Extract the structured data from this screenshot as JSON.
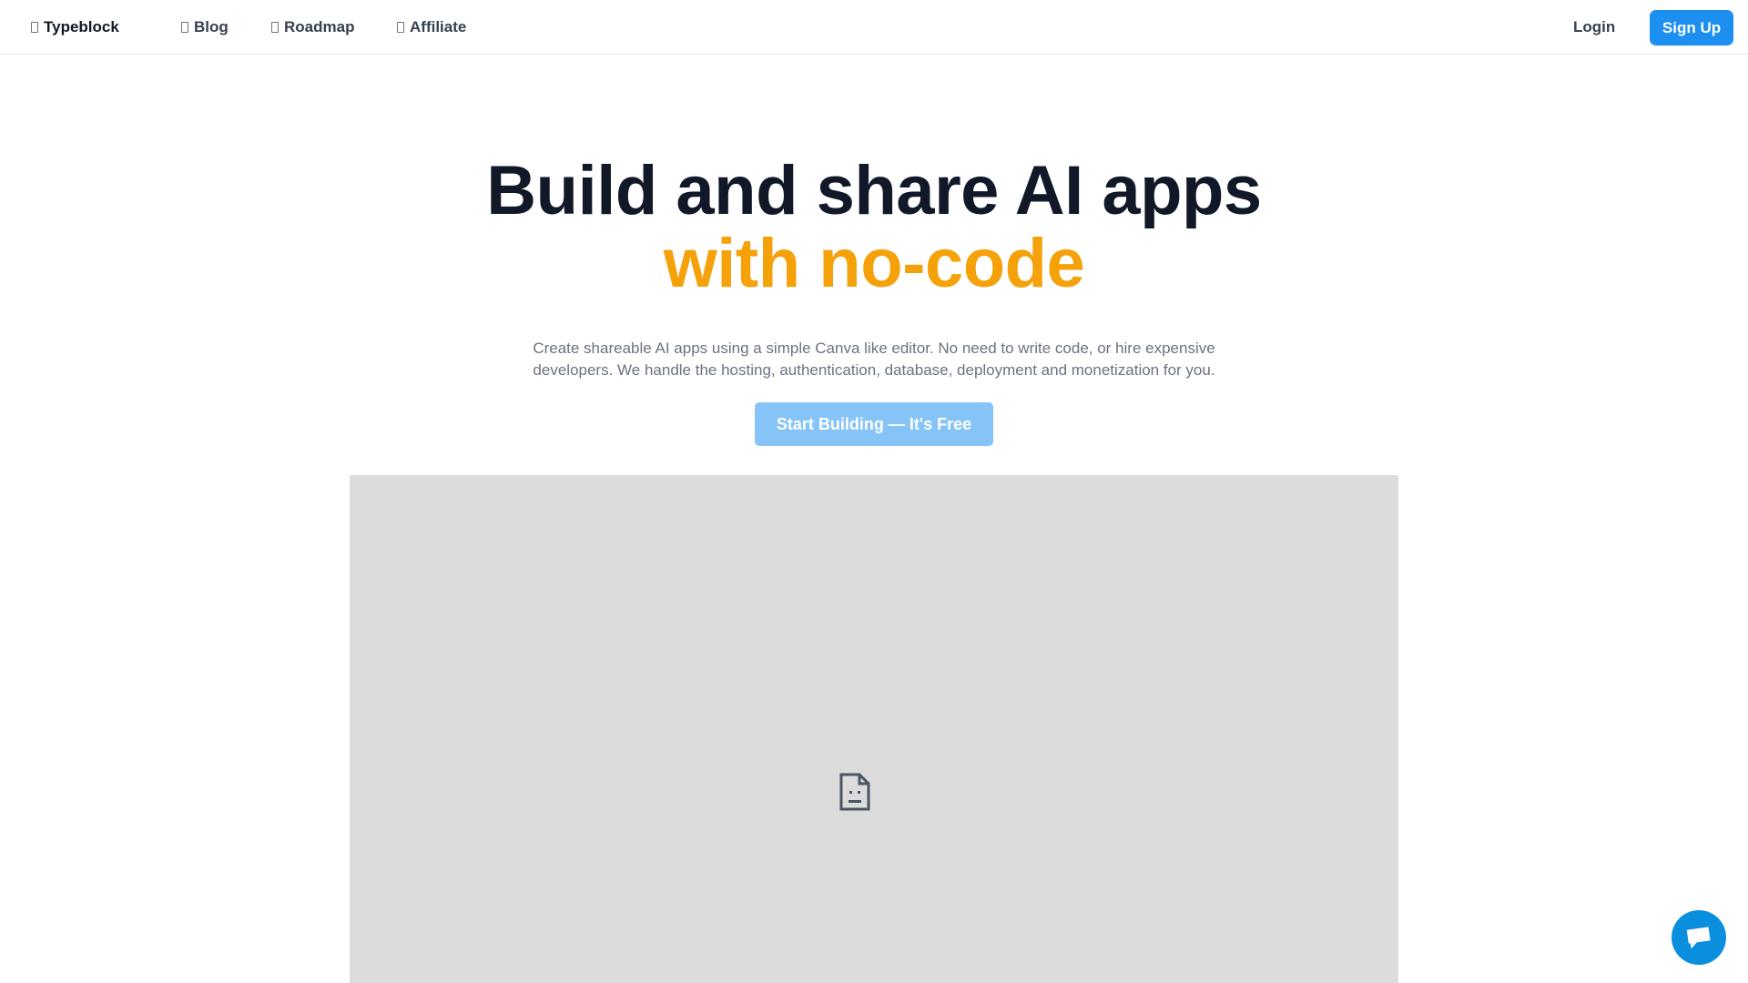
{
  "nav": {
    "brand": "Typeblock",
    "links": [
      {
        "label": "Blog"
      },
      {
        "label": "Roadmap"
      },
      {
        "label": "Affiliate"
      }
    ],
    "login_label": "Login",
    "signup_label": "Sign Up"
  },
  "hero": {
    "title_line1": "Build and share AI apps",
    "title_line2": "with no-code",
    "subtitle_line1": "Create shareable AI apps using a simple Canva like editor. No need to write code, or hire expensive",
    "subtitle_line2": "developers. We handle the hosting, authentication, database, deployment and monetization for you.",
    "cta_label": "Start Building — It's Free"
  },
  "preview": {
    "icon": "broken-document-icon"
  },
  "chat": {
    "icon": "chat-bubble-icon"
  },
  "colors": {
    "accent": "#f5a10a",
    "primary": "#1d8ff0",
    "cta_bg": "#86c4f7",
    "chat_bg": "#0a8fdf",
    "preview_bg": "#dcdcdc"
  }
}
